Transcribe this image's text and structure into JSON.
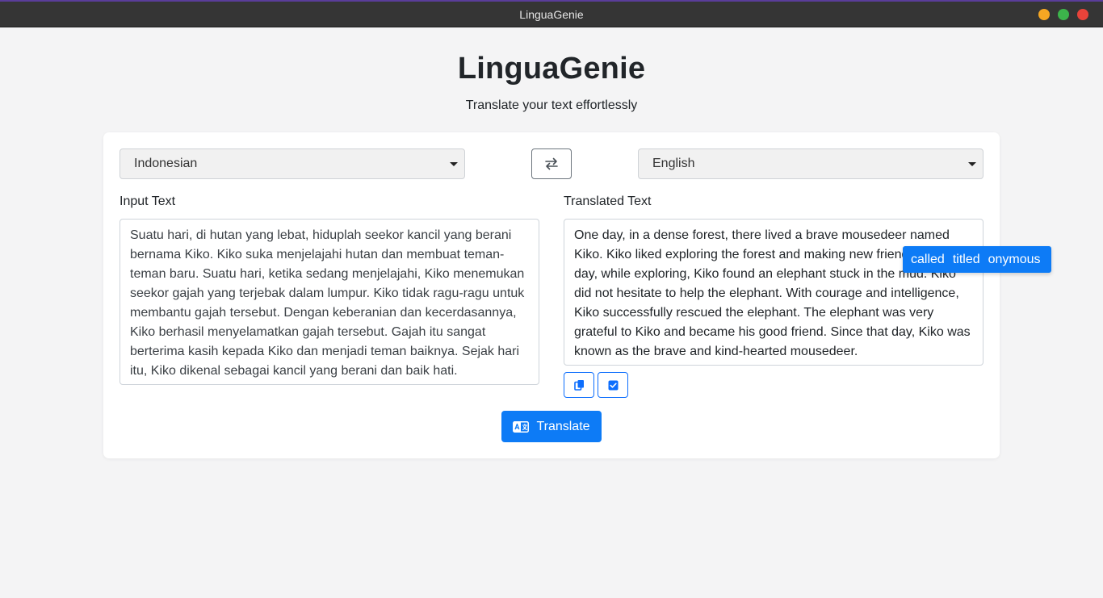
{
  "window": {
    "title": "LinguaGenie"
  },
  "header": {
    "title": "LinguaGenie",
    "subtitle": "Translate your text effortlessly"
  },
  "languages": {
    "source": "Indonesian",
    "target": "English"
  },
  "input": {
    "label": "Input Text",
    "text": "Suatu hari, di hutan yang lebat, hiduplah seekor kancil yang berani bernama Kiko. Kiko suka menjelajahi hutan dan membuat teman-teman baru. Suatu hari, ketika sedang menjelajahi, Kiko menemukan seekor gajah yang terjebak dalam lumpur. Kiko tidak ragu-ragu untuk membantu gajah tersebut. Dengan keberanian dan kecerdasannya, Kiko berhasil menyelamatkan gajah tersebut. Gajah itu sangat berterima kasih kepada Kiko dan menjadi teman baiknya. Sejak hari itu, Kiko dikenal sebagai kancil yang berani dan baik hati."
  },
  "output": {
    "label": "Translated Text",
    "text": "One day, in a dense forest, there lived a brave mousedeer named Kiko. Kiko liked exploring the forest and making new friends. One day, while exploring, Kiko found an elephant stuck in the mud. Kiko did not hesitate to help the elephant. With courage and intelligence, Kiko successfully rescued the elephant. The elephant was very grateful to Kiko and became his good friend. Since that day, Kiko was known as the brave and kind-hearted mousedeer."
  },
  "actions": {
    "translate_label": "Translate"
  },
  "suggestions": [
    "called",
    "titled",
    "onymous"
  ],
  "icons": {
    "swap": "swap-arrows-icon",
    "copy": "copy-icon",
    "check": "check-square-icon",
    "translate": "translate-icon"
  },
  "colors": {
    "accent": "#0d7bf6",
    "titlebar": "#353535"
  }
}
